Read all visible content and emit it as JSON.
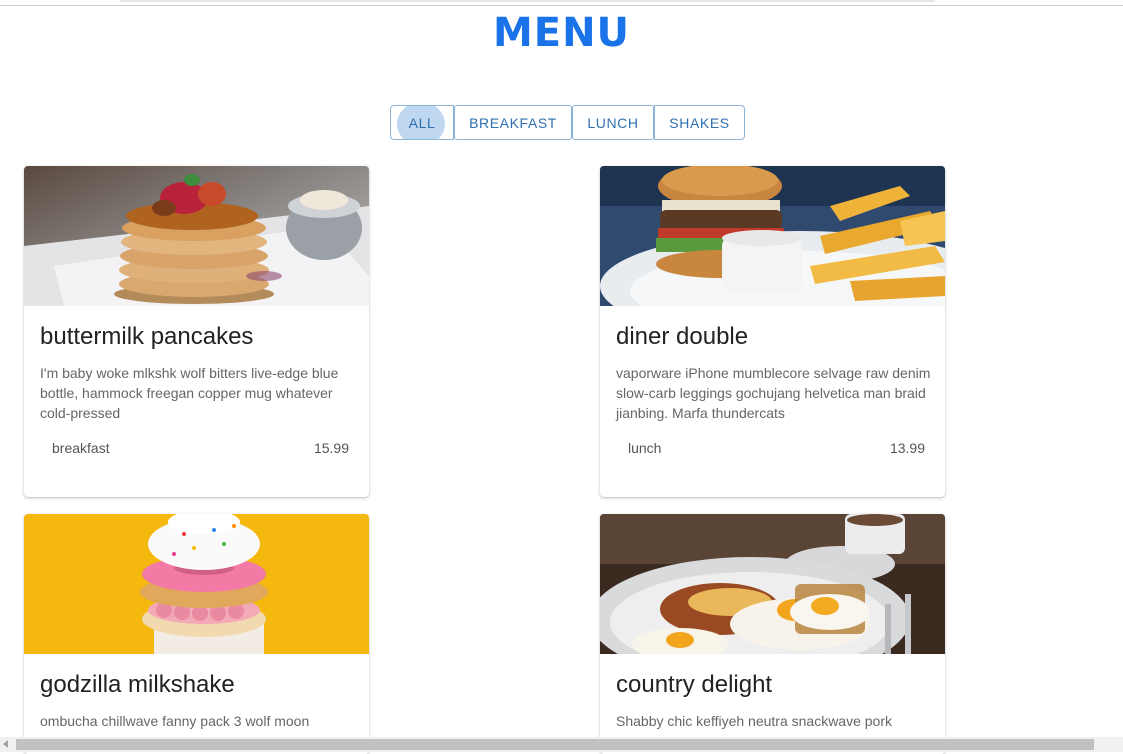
{
  "header": {
    "title": "MENU"
  },
  "filters": [
    {
      "label": "ALL"
    },
    {
      "label": "BREAKFAST"
    },
    {
      "label": "LUNCH"
    },
    {
      "label": "SHAKES"
    }
  ],
  "colors": {
    "accent": "#1a73e8",
    "filter_text": "#2f6fb0",
    "filter_border": "#8ab4d8",
    "active_ripple": "#bfd8f0"
  },
  "items": [
    {
      "title": "buttermilk pancakes",
      "desc": "I'm baby woke mlkshk wolf bitters live-edge blue bottle, hammock freegan copper mug whatever cold-pressed",
      "category": "breakfast",
      "price": "15.99",
      "image_icon": "pancakes-photo"
    },
    {
      "title": "diner double",
      "desc": "vaporware iPhone mumblecore selvage raw denim slow-carb leggings gochujang helvetica man braid jianbing. Marfa thundercats",
      "category": "lunch",
      "price": "13.99",
      "image_icon": "burger-fries-photo"
    },
    {
      "title": "godzilla milkshake",
      "desc": "ombucha chillwave fanny pack 3 wolf moon",
      "image_icon": "milkshake-photo"
    },
    {
      "title": "country delight",
      "desc": "Shabby chic keffiyeh neutra snackwave pork",
      "image_icon": "eggs-breakfast-photo"
    }
  ]
}
